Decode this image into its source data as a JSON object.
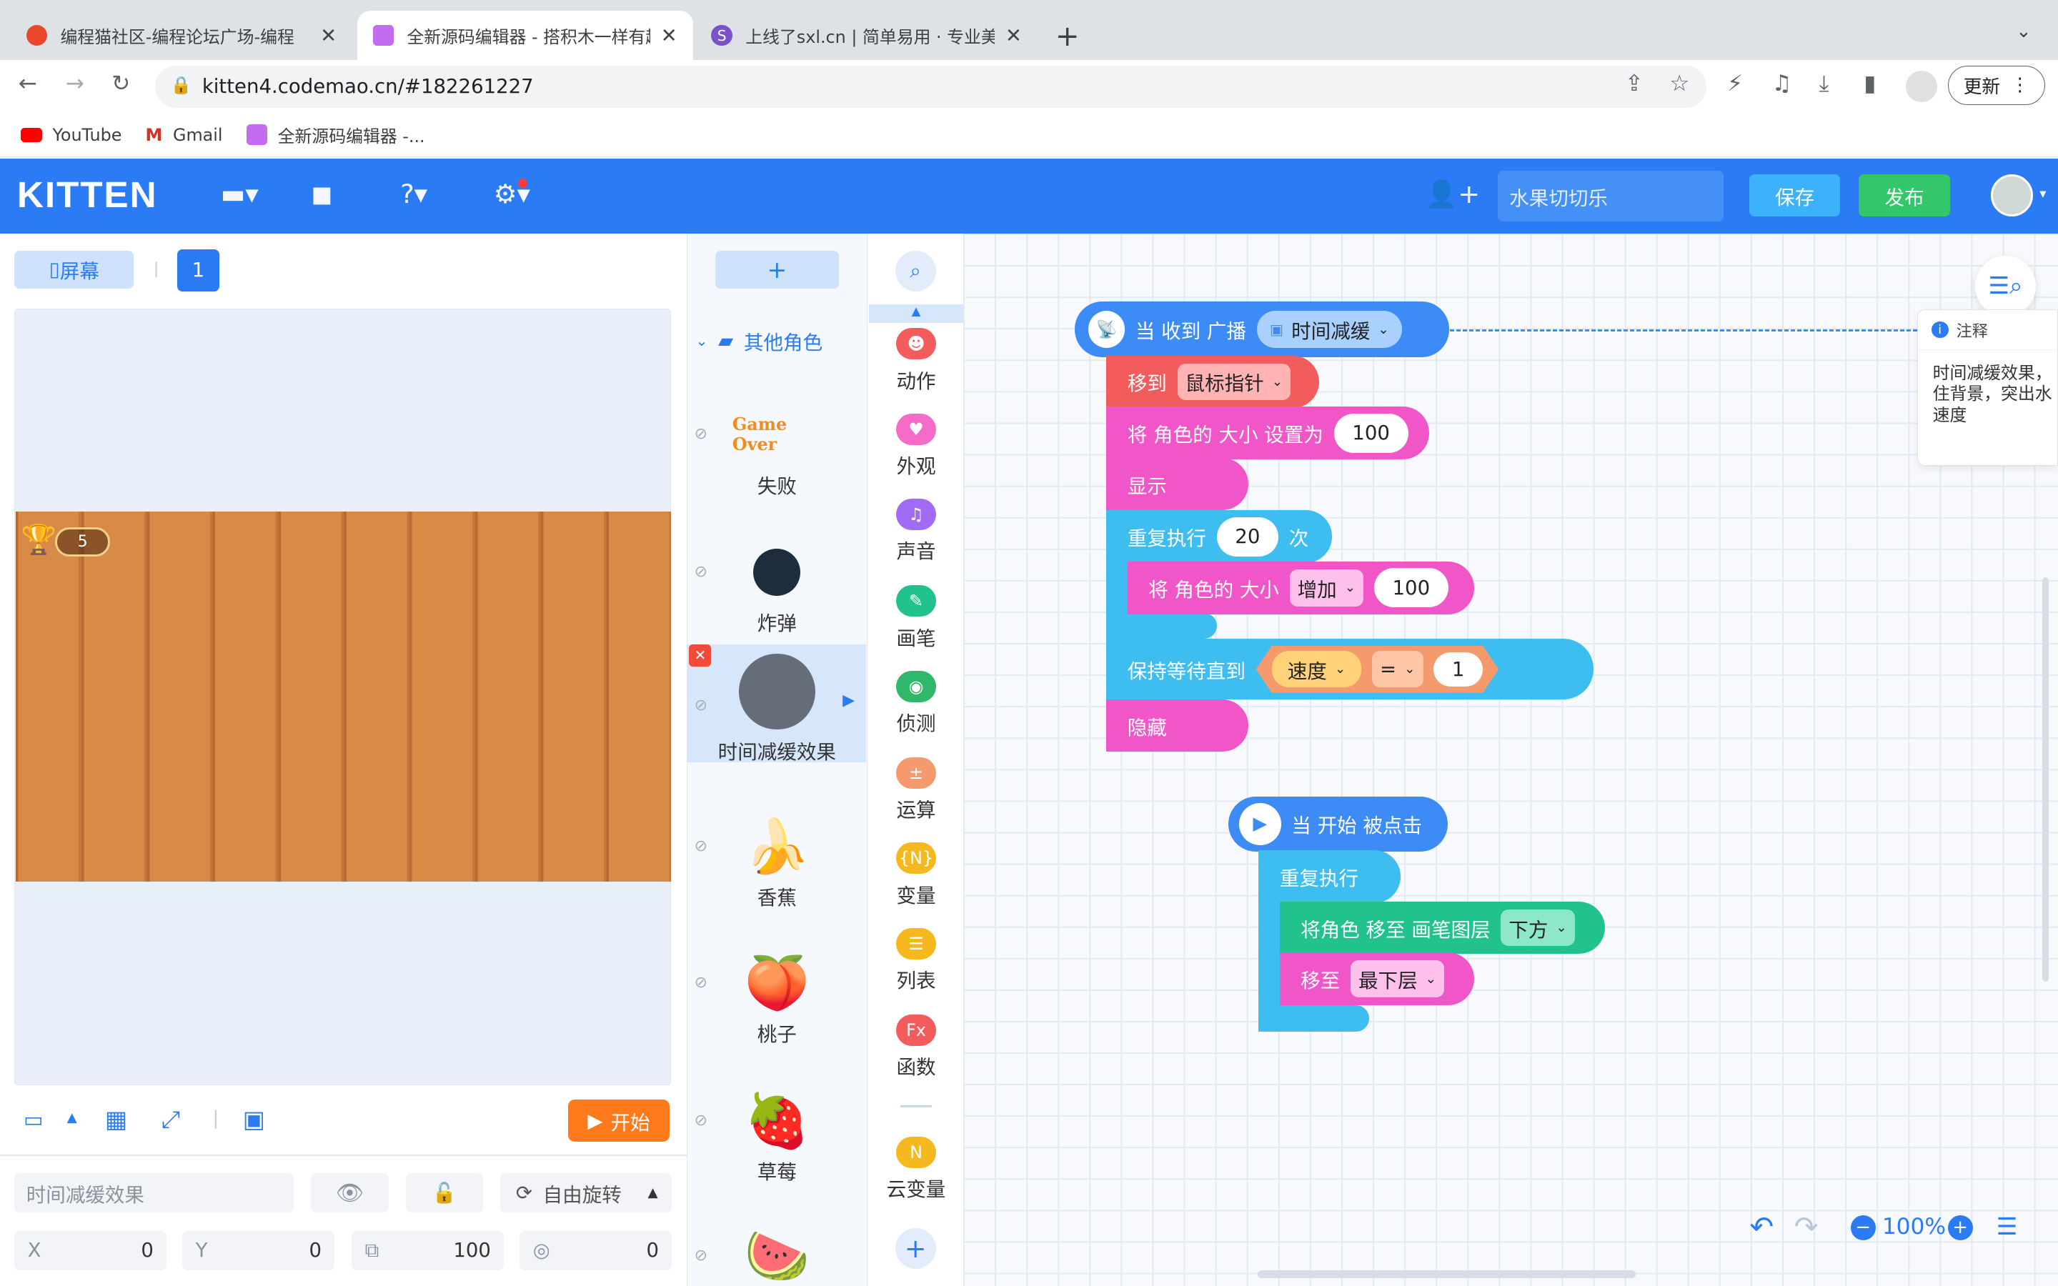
{
  "browser": {
    "tabs": [
      {
        "title": "编程猫社区-编程论坛广场-编程",
        "fav_color": "#e8472c"
      },
      {
        "title": "全新源码编辑器 - 搭积木一样有趣",
        "fav_color": "#c46cf0"
      },
      {
        "title": "上线了sxl.cn | 简单易用 · 专业美",
        "fav_color": "#7b52c9"
      }
    ],
    "url": "kitten4.codemao.cn/#182261227",
    "update_label": "更新",
    "bookmarks": [
      "YouTube",
      "Gmail",
      "全新源码编辑器 -..."
    ]
  },
  "header": {
    "logo": "KITTEN",
    "work_name": "水果切切乐",
    "save_label": "保存",
    "publish_label": "发布"
  },
  "stage": {
    "screen_label": "屏幕",
    "scene_number": "1",
    "score": "5",
    "run_label": "开始"
  },
  "sprite_props": {
    "name": "时间减缓效果",
    "rotation_label": "自由旋转",
    "x_label": "X",
    "x": "0",
    "y_label": "Y",
    "y": "0",
    "size": "100",
    "direction": "0"
  },
  "sprite_list": {
    "add_label": "+",
    "folder": "其他角色",
    "items": [
      "失败",
      "炸弹",
      "时间减缓效果",
      "香蕉",
      "桃子",
      "草莓"
    ],
    "gameover_text": "Game Over"
  },
  "categories": [
    "动作",
    "外观",
    "声音",
    "画笔",
    "侦测",
    "运算",
    "变量",
    "列表",
    "函数",
    "云变量"
  ],
  "category_colors": [
    "#f25c5c",
    "#f56bc8",
    "#a06cf5",
    "#22c28e",
    "#30b86a",
    "#f59a6c",
    "#f5b81e",
    "#f5b81e",
    "#f25c5c",
    "#f5b81e"
  ],
  "category_glyphs": [
    "☻",
    "♥",
    "♫",
    "✎",
    "◉",
    "±",
    "{N}",
    "☰",
    "Fx",
    "N"
  ],
  "script1": {
    "hat": "当 收到 广播",
    "broadcast": "时间减缓",
    "move_to": "移到",
    "move_target": "鼠标指针",
    "set_size": "将 角色的 大小 设置为",
    "set_size_value": "100",
    "show": "显示",
    "repeat": "重复执行",
    "repeat_count": "20",
    "repeat_suffix": "次",
    "change_size": "将 角色的 大小",
    "change_op": "增加",
    "change_value": "100",
    "wait_until": "保持等待直到",
    "var": "速度",
    "cmp": "=",
    "cmp_value": "1",
    "hide": "隐藏"
  },
  "script2": {
    "hat": "当 开始 被点击",
    "forever": "重复执行",
    "layer": "将角色 移至 画笔图层",
    "layer_pos": "下方",
    "move_layer": "移至",
    "move_layer_pos": "最下层"
  },
  "comment": {
    "title": "注释",
    "text": "时间减缓效果，住背景，突出水速度"
  },
  "zoom": "100%"
}
